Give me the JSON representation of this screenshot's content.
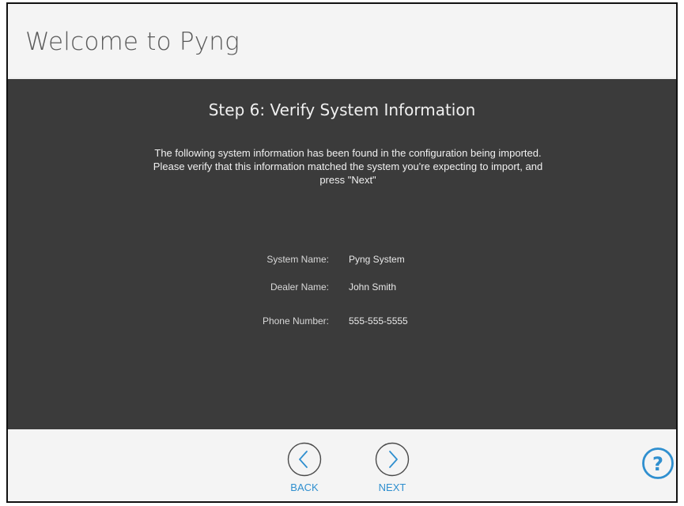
{
  "header": {
    "title": "Welcome to Pyng"
  },
  "step": {
    "title": "Step 6: Verify System Information",
    "description": "The following system information has been found in the configuration being imported. Please verify that this information matched the system you're expecting to import, and press \"Next\""
  },
  "system_info": [
    {
      "label": "System Name:",
      "value": "Pyng System"
    },
    {
      "label": "Dealer Name:",
      "value": "John Smith"
    },
    {
      "label": "Phone Number:",
      "value": "555-555-5555"
    }
  ],
  "footer": {
    "back_label": "BACK",
    "next_label": "NEXT",
    "back_icon": "chevron-left-icon",
    "next_icon": "chevron-right-icon",
    "help_icon": "question-mark-icon"
  },
  "colors": {
    "accent": "#2f8fcf",
    "panel_bg": "#3b3b3b",
    "page_bg": "#f4f4f4"
  }
}
